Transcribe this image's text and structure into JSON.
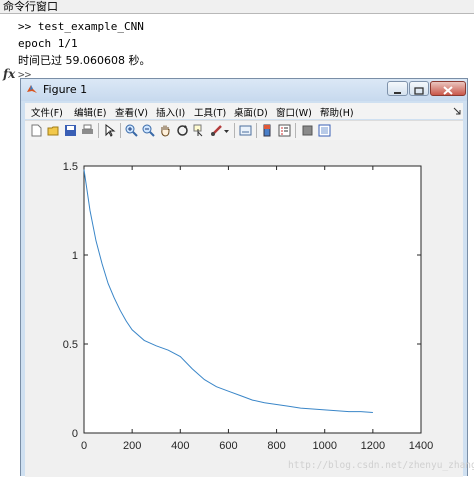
{
  "command_window": {
    "title": "命令行窗口",
    "line1": ">> test_example_CNN",
    "line2": "epoch 1/1",
    "line3": "时间已过 59.060608 秒。",
    "fx_label": "fx",
    "prompt": ">>"
  },
  "figure": {
    "title": "Figure 1",
    "menu": [
      "文件(F)",
      "编辑(E)",
      "查看(V)",
      "插入(I)",
      "工具(T)",
      "桌面(D)",
      "窗口(W)",
      "帮助(H)"
    ]
  },
  "chart_data": {
    "type": "line",
    "title": "",
    "xlabel": "",
    "ylabel": "",
    "xlim": [
      0,
      1400
    ],
    "ylim": [
      0,
      1.5
    ],
    "xticks": [
      "0",
      "200",
      "400",
      "600",
      "800",
      "1000",
      "1200",
      "1400"
    ],
    "yticks": [
      "0",
      "0.5",
      "1",
      "1.5"
    ],
    "grid": false,
    "series": [
      {
        "color": "#3a86c8",
        "x": [
          0,
          25,
          50,
          75,
          100,
          125,
          150,
          175,
          200,
          250,
          300,
          350,
          400,
          450,
          500,
          550,
          600,
          650,
          700,
          750,
          800,
          850,
          900,
          950,
          1000,
          1050,
          1100,
          1150,
          1200
        ],
        "y": [
          1.48,
          1.25,
          1.08,
          0.95,
          0.84,
          0.76,
          0.69,
          0.63,
          0.58,
          0.52,
          0.49,
          0.465,
          0.43,
          0.36,
          0.3,
          0.26,
          0.235,
          0.21,
          0.185,
          0.17,
          0.16,
          0.15,
          0.14,
          0.135,
          0.13,
          0.125,
          0.12,
          0.12,
          0.115
        ]
      }
    ]
  },
  "watermark": "http://blog.csdn.net/zhenyu_zhang"
}
